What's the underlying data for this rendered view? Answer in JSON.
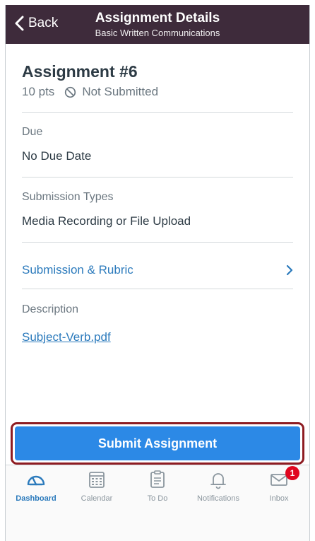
{
  "navbar": {
    "back_label": "Back",
    "title": "Assignment Details",
    "subtitle": "Basic Written Communications"
  },
  "assignment": {
    "title": "Assignment #6",
    "points": "10 pts",
    "status": "Not Submitted"
  },
  "sections": {
    "due_label": "Due",
    "due_value": "No Due Date",
    "types_label": "Submission Types",
    "types_value": "Media Recording or File Upload",
    "rubric_link": "Submission & Rubric",
    "description_label": "Description",
    "file_link": "Subject-Verb.pdf"
  },
  "submit_label": "Submit Assignment",
  "tabs": [
    {
      "label": "Dashboard",
      "icon": "dashboard-icon",
      "active": true
    },
    {
      "label": "Calendar",
      "icon": "calendar-icon",
      "active": false
    },
    {
      "label": "To Do",
      "icon": "todo-icon",
      "active": false
    },
    {
      "label": "Notifications",
      "icon": "bell-icon",
      "active": false
    },
    {
      "label": "Inbox",
      "icon": "inbox-icon",
      "active": false,
      "badge": "1"
    }
  ],
  "colors": {
    "navbar": "#3e2b3b",
    "link": "#2b7abc",
    "submit": "#2c89e6",
    "highlight": "#8e1c22",
    "badge": "#e0061f"
  }
}
